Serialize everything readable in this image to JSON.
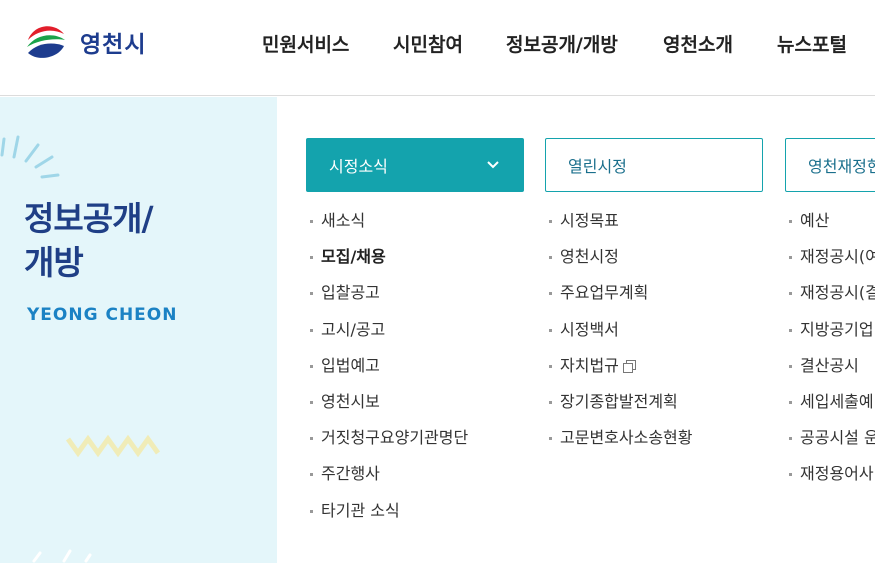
{
  "header": {
    "logo_text": "영천시",
    "nav": [
      "민원서비스",
      "시민참여",
      "정보공개/개방",
      "영천소개",
      "뉴스포털"
    ]
  },
  "section": {
    "title_line1": "정보공개/",
    "title_line2": "개방",
    "subtitle": "YEONG CHEON"
  },
  "columns": [
    {
      "title": "시정소식",
      "active": true,
      "items": [
        "새소식",
        "모집/채용",
        "입찰공고",
        "고시/공고",
        "입법예고",
        "영천시보",
        "거짓청구요양기관명단",
        "주간행사",
        "타기관 소식"
      ]
    },
    {
      "title": "열린시정",
      "active": false,
      "items": [
        "시정목표",
        "영천시정",
        "주요업무계획",
        "시정백서",
        "자치법규",
        "장기종합발전계획",
        "고문변호사소송현황"
      ]
    },
    {
      "title": "영천재정현",
      "active": false,
      "items": [
        "예산",
        "재정공시(여",
        "재정공시(결",
        "지방공기업",
        "결산공시",
        "세입세출예",
        "공공시설 운",
        "재정용어사"
      ]
    }
  ],
  "colors": {
    "accent": "#14a3ad",
    "brand_blue": "#1f3f86",
    "panel_bg": "#e4f6fa"
  }
}
